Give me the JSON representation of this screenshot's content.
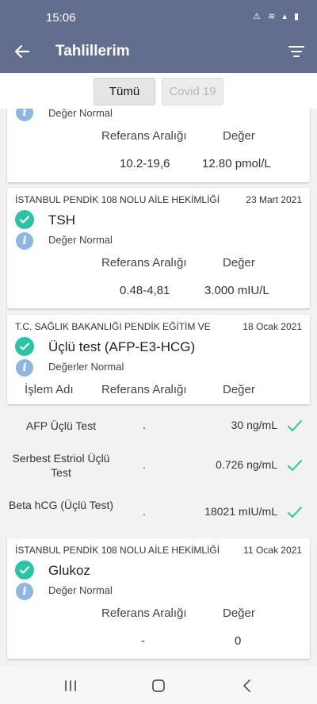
{
  "status_bar": {
    "time": "15:06",
    "icons": "⚠ ≋ ▴ ▮"
  },
  "header": {
    "title": "Tahlillerim"
  },
  "tabs": [
    {
      "label": "Tümü",
      "selected": true
    },
    {
      "label": "Covid 19",
      "selected": false
    }
  ],
  "cards": [
    {
      "status": "Değer Normal",
      "ref_label": "Referans Aralığı",
      "value_label": "Değer",
      "ref_value": "10.2-19,6",
      "value": "12.80 pmol/L"
    },
    {
      "lab": "İSTANBUL PENDİK 108 NOLU AİLE HEKİMLİĞİ",
      "date": "23 Mart 2021",
      "test": "TSH",
      "status": "Değer Normal",
      "ref_label": "Referans Aralığı",
      "value_label": "Değer",
      "ref_value": "0.48-4,81",
      "value": "3.000 mIU/L"
    },
    {
      "lab": "T.C. SAĞLIK BAKANLIĞI PENDİK EĞİTİM VE",
      "date": "18 Ocak 2021",
      "test": "Üçlü test (AFP-E3-HCG)",
      "status": "Değerler Normal",
      "name_label": "İşlem Adı",
      "ref_label": "Referans Aralığı",
      "value_label": "Değer",
      "rows": [
        {
          "name": "AFP Üçlü Test",
          "ref": ".",
          "value": "30 ng/mL"
        },
        {
          "name": "Serbest Estriol Üçlü Test",
          "ref": ".",
          "value": "0.726 ng/mL"
        },
        {
          "name": "Beta hCG (Üçlü Test)",
          "ref": ".",
          "value": "18021 mIU/mL"
        }
      ]
    },
    {
      "lab": "İSTANBUL PENDİK 108 NOLU AİLE HEKİMLİĞİ",
      "date": "11 Ocak 2021",
      "test": "Glukoz",
      "status": "Değer Normal",
      "ref_label": "Referans Aralığı",
      "value_label": "Değer",
      "ref_value": "-",
      "value": "0"
    }
  ],
  "colors": {
    "accent": "#636e8e",
    "check": "#2cc2a4",
    "info": "#8fb5e2"
  }
}
